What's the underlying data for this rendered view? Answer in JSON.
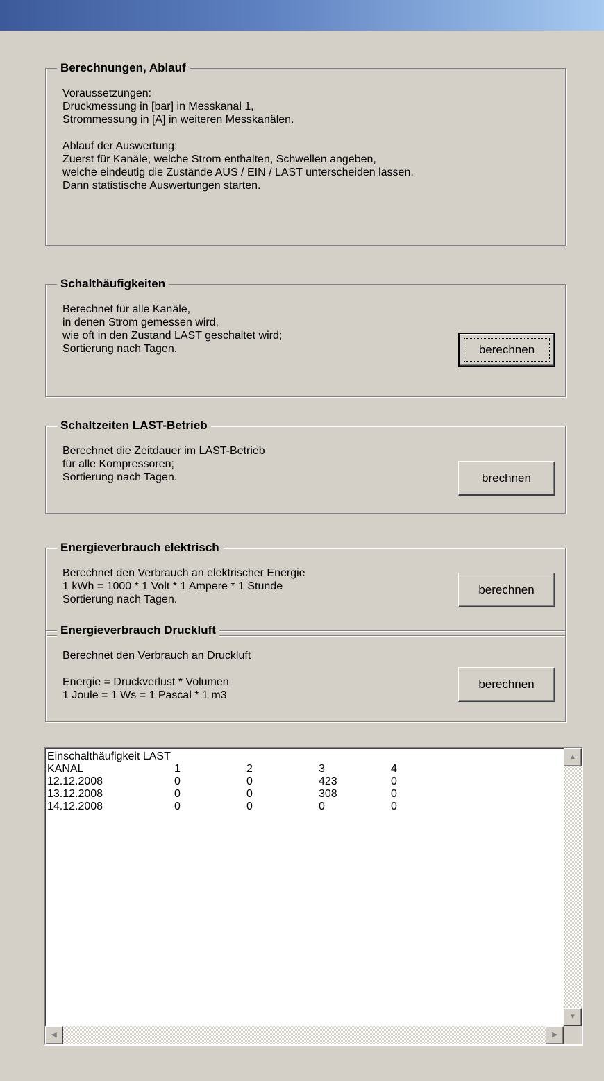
{
  "groups": [
    {
      "title": "Berechnungen, Ablauf",
      "lines": "Voraussetzungen:\nDruckmessung in [bar] in Messkanal 1,\nStrommessung in [A] in weiteren Messkanälen.\n\nAblauf der Auswertung:\nZuerst für Kanäle, welche Strom enthalten, Schwellen angeben,\nwelche eindeutig die Zustände AUS / EIN / LAST unterscheiden lassen.\nDann statistische Auswertungen starten."
    },
    {
      "title": "Schalthäufigkeiten",
      "lines": "Berechnet für alle Kanäle,\nin denen Strom gemessen wird,\nwie oft in den Zustand LAST geschaltet wird;\nSortierung nach Tagen.",
      "button": "berechnen"
    },
    {
      "title": "Schaltzeiten LAST-Betrieb",
      "lines": "Berechnet die Zeitdauer im LAST-Betrieb\nfür alle Kompressoren;\nSortierung nach Tagen.",
      "button": "brechnen"
    },
    {
      "title": "Energieverbrauch elektrisch",
      "lines": "Berechnet den Verbrauch an elektrischer Energie\n1 kWh = 1000 * 1 Volt * 1 Ampere * 1 Stunde\nSortierung nach Tagen.",
      "button": "berechnen"
    },
    {
      "title": "Energieverbrauch Druckluft",
      "lines": "Berechnet den Verbrauch an Druckluft\n\nEnergie = Druckverlust * Volumen\n1 Joule = 1 Ws = 1 Pascal * 1 m3",
      "button": "berechnen"
    }
  ],
  "output": {
    "title": "Einschalthäufigkeit LAST",
    "header": [
      "KANAL",
      "1",
      "2",
      "3",
      "4"
    ],
    "rows": [
      [
        "12.12.2008",
        "0",
        "0",
        "423",
        "0"
      ],
      [
        "13.12.2008",
        "0",
        "0",
        "308",
        "0"
      ],
      [
        "14.12.2008",
        "0",
        "0",
        "0",
        "0"
      ]
    ]
  },
  "icons": {
    "scroll_up": "▲",
    "scroll_down": "▼",
    "scroll_left": "◀",
    "scroll_right": "▶"
  }
}
